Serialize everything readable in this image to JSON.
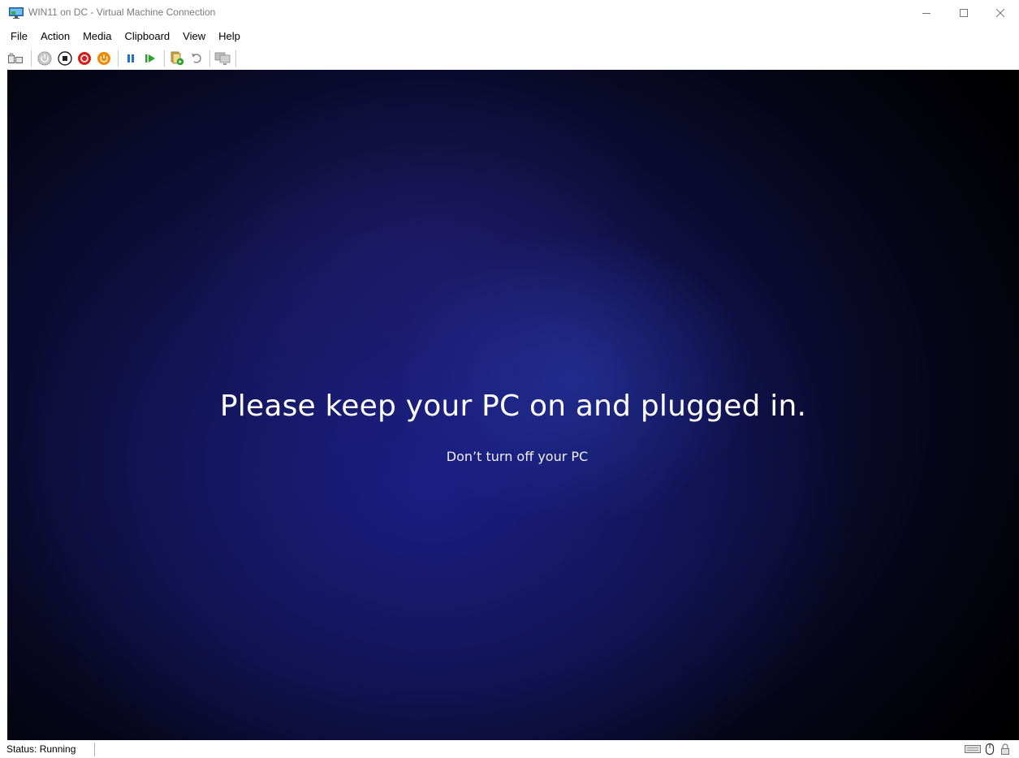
{
  "window": {
    "title": "WIN11 on DC - Virtual Machine Connection",
    "icon": "vm-monitor-icon"
  },
  "menu": {
    "items": [
      "File",
      "Action",
      "Media",
      "Clipboard",
      "View",
      "Help"
    ]
  },
  "toolbar": {
    "icons": [
      "ctrl-alt-del-icon",
      "start-icon",
      "turn-off-icon",
      "shut-down-icon",
      "save-icon",
      "pause-icon",
      "resume-icon",
      "checkpoint-icon",
      "revert-icon",
      "enhanced-session-icon"
    ]
  },
  "vm": {
    "message": "Please keep your PC on and plugged in.",
    "submessage": "Don’t turn off your PC"
  },
  "status": {
    "text": "Status: Running",
    "icons": [
      "keyboard-icon",
      "mouse-icon",
      "lock-icon"
    ]
  },
  "colors": {
    "accent_green": "#2aa52a",
    "accent_red": "#d42020",
    "accent_orange": "#f08a00",
    "accent_blue": "#1f6fd1",
    "vm_background": "#0c0c35"
  }
}
